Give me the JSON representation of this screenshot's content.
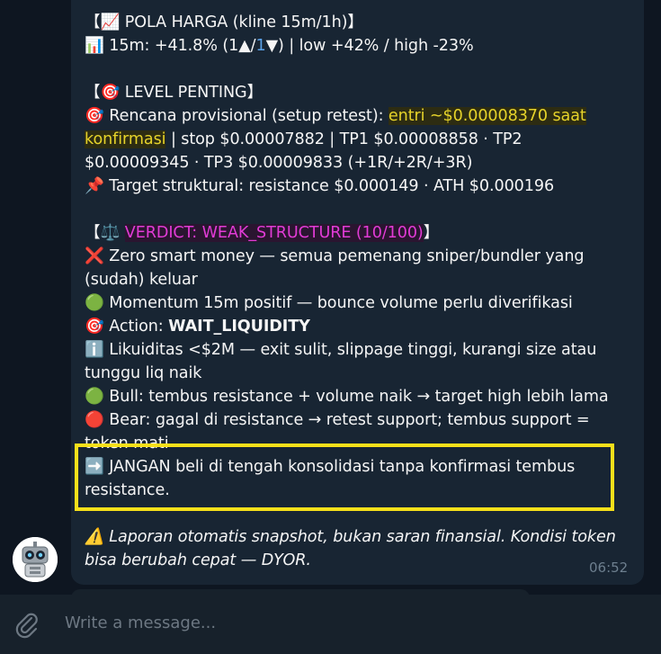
{
  "message": {
    "pola_title": "【📈 POLA HARGA (kline 15m/1h)】",
    "pola_line_icon": "📊",
    "pola_line_a": " 15m: +41.8% (1▲/",
    "pola_line_b": "1",
    "pola_line_c": "▼) | low +42% / high -23%",
    "level_title": "【🎯 LEVEL PENTING】",
    "plan_icon": "🎯",
    "plan_label": " Rencana provisional (setup retest): ",
    "plan_highlight_1": "entri ~$0.00008370 saat",
    "plan_highlight_2": "konfirmasi",
    "plan_rest_1": " | stop $0.00007882 | TP1 $0.00008858 · TP2",
    "plan_rest_2": "$0.00009345 · TP3 $0.00009833 (+1R/+2R/+3R)",
    "target_icon": "📌",
    "target_text": " Target struktural: resistance $0.000149 · ATH $0.000196",
    "verdict_prefix": "【⚖️ ",
    "verdict_highlight": "VERDICT: WEAK_STRUCTURE (10/100)",
    "verdict_suffix": "】",
    "zero_icon": "❌",
    "zero_text_1": " Zero smart money — semua pemenang sniper/bundler yang",
    "zero_text_2": "(sudah) keluar",
    "momentum_icon": "🟢",
    "momentum_text": " Momentum 15m positif — bounce volume perlu diverifikasi",
    "action_icon": "🎯",
    "action_label": " Action: ",
    "action_value": "WAIT_LIQUIDITY",
    "liq_icon": "ℹ️",
    "liq_text_1": " Likuiditas <$2M — exit sulit, slippage tinggi, kurangi size atau",
    "liq_text_2": "tunggu liq naik",
    "bull_icon": "🟢",
    "bull_text": " Bull: tembus resistance + volume naik → target high lebih lama",
    "bear_icon": "🔴",
    "bear_text_1": " Bear: gagal di resistance → retest support; tembus support =",
    "bear_text_2": "token mati",
    "warn_arrow_icon": "➡️",
    "warn_text_1": " JANGAN beli di tengah konsolidasi tanpa konfirmasi tembus",
    "warn_text_2": "resistance.",
    "disclaimer_icon": "⚠️",
    "disclaimer_1": " Laporan otomatis snapshot, bukan saran finansial. Kondisi token",
    "disclaimer_2": "bisa berubah cepat — DYOR.",
    "time": "06:52"
  },
  "composer": {
    "placeholder": "Write a message..."
  },
  "colors": {
    "background": "#0e1621",
    "bubble": "#182533",
    "highlight_yellow": "#e6d32a",
    "highlight_magenta": "#e23bd6",
    "annotation_box": "#f7e01a",
    "link_blue": "#5ba2e8"
  },
  "icons": {
    "avatar": "robot-avatar-icon",
    "attach": "paperclip-icon"
  }
}
